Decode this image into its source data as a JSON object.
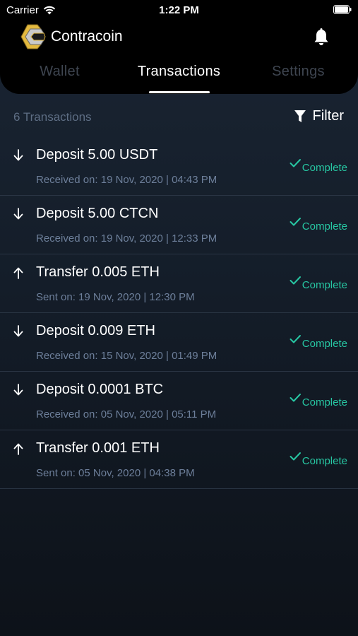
{
  "status_bar": {
    "carrier": "Carrier",
    "time": "1:22 PM"
  },
  "app": {
    "name": "Contracoin"
  },
  "tabs": [
    {
      "label": "Wallet",
      "active": false
    },
    {
      "label": "Transactions",
      "active": true
    },
    {
      "label": "Settings",
      "active": false
    }
  ],
  "toolbar": {
    "count_label": "6 Transactions",
    "filter_label": "Filter"
  },
  "colors": {
    "accent_green": "#27c7a3",
    "muted_text": "#6d7f9a",
    "header_bg": "#000000"
  },
  "transactions": [
    {
      "direction": "down",
      "title": "Deposit 5.00 USDT",
      "subtitle": "Received on: 19 Nov, 2020 | 04:43 PM",
      "status": "Complete"
    },
    {
      "direction": "down",
      "title": "Deposit 5.00 CTCN",
      "subtitle": "Received on: 19 Nov, 2020 | 12:33 PM",
      "status": "Complete"
    },
    {
      "direction": "up",
      "title": "Transfer 0.005 ETH",
      "subtitle": "Sent on: 19 Nov, 2020 | 12:30 PM",
      "status": "Complete"
    },
    {
      "direction": "down",
      "title": "Deposit 0.009 ETH",
      "subtitle": "Received on: 15 Nov, 2020 | 01:49 PM",
      "status": "Complete"
    },
    {
      "direction": "down",
      "title": "Deposit 0.0001 BTC",
      "subtitle": "Received on: 05 Nov, 2020 | 05:11 PM",
      "status": "Complete"
    },
    {
      "direction": "up",
      "title": "Transfer 0.001 ETH",
      "subtitle": "Sent on: 05 Nov, 2020 | 04:38 PM",
      "status": "Complete"
    }
  ]
}
